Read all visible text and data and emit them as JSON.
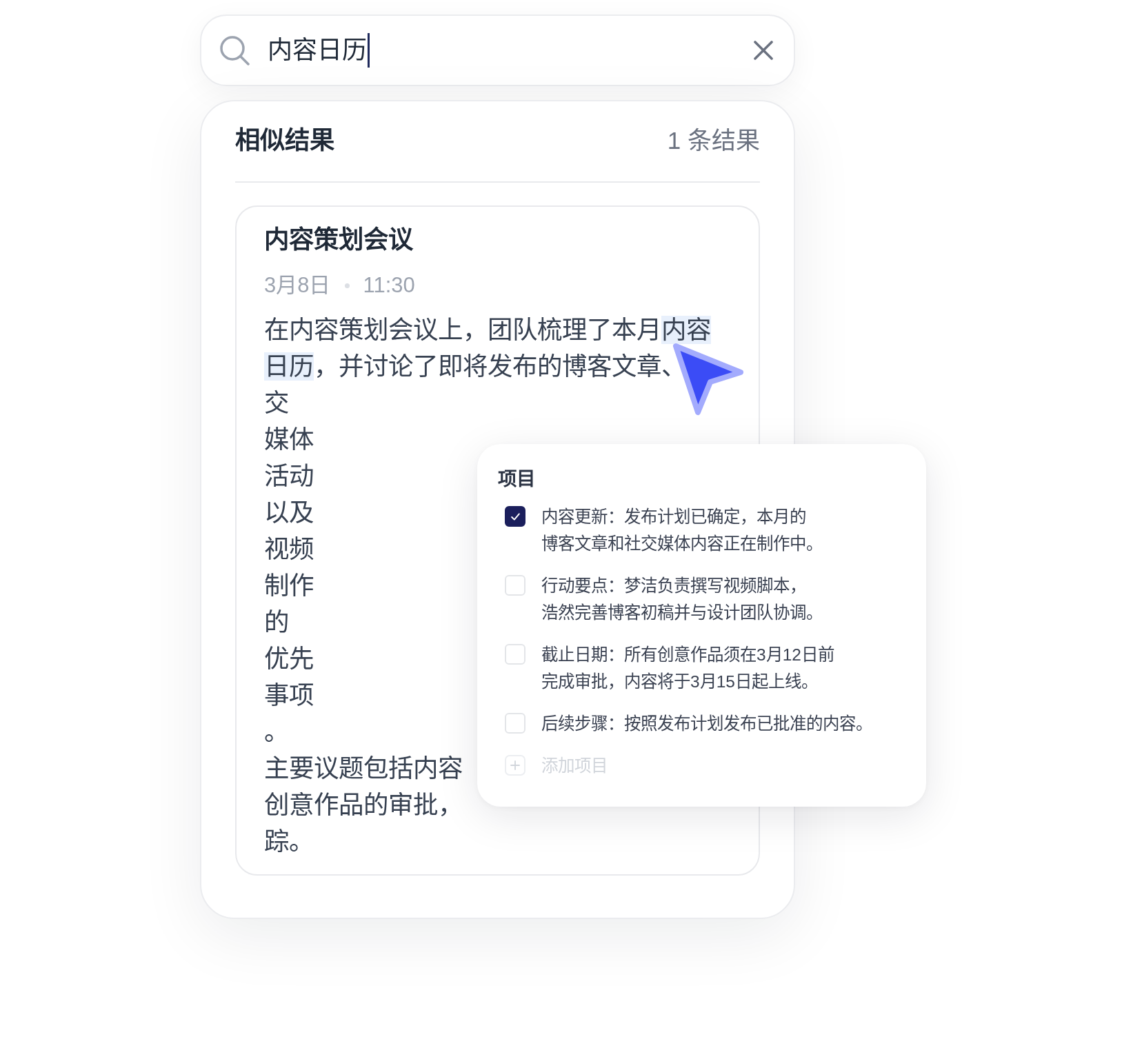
{
  "search": {
    "value": "内容日历"
  },
  "results": {
    "title": "相似结果",
    "count": "1 条结果",
    "items": [
      {
        "title": "内容策划会议",
        "date": "3月8日",
        "time": "11:30",
        "body": {
          "segments": [
            {
              "text": "在内容策划会议上，团队梳理了本月",
              "highlighted": false
            },
            {
              "text": "内容日历",
              "highlighted": true
            },
            {
              "text": "，并讨论了即将发布的博客文章、",
              "highlighted": false
            }
          ],
          "lines": [
            "交",
            "媒体",
            "活动",
            "以及",
            "视频",
            "制作",
            "的",
            "优先",
            "事项",
            "。",
            "主要议题包括内容",
            "创意作品的审批，",
            "踪。"
          ]
        }
      }
    ]
  },
  "popup": {
    "title": "项目",
    "items": [
      {
        "lines": [
          "内容更新：发布计划已确定，本月的",
          "博客文章和社交媒体内容正在制作中。"
        ],
        "checked": true
      },
      {
        "lines": [
          "行动要点：梦洁负责撰写视频脚本，",
          "浩然完善博客初稿并与设计团队协调。"
        ],
        "checked": false
      },
      {
        "lines": [
          "截止日期：所有创意作品须在3月12日前",
          "完成审批，内容将于3月15日起上线。"
        ],
        "checked": false
      },
      {
        "lines": [
          "后续步骤：按照发布计划发布已批准的内容。"
        ],
        "checked": false
      }
    ],
    "add_label": "添加项目"
  }
}
